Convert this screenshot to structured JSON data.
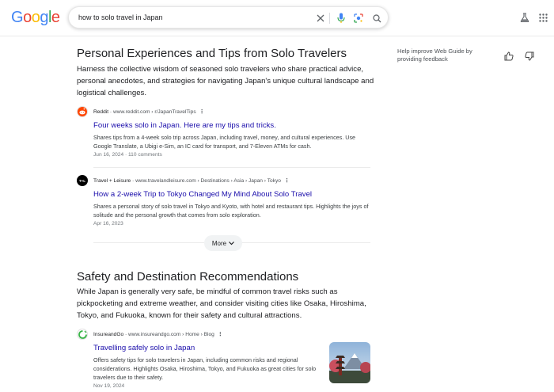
{
  "header": {
    "logo": [
      "G",
      "o",
      "o",
      "g",
      "l",
      "e"
    ],
    "logo_colors": [
      "#4285F4",
      "#EA4335",
      "#FBBC05",
      "#4285F4",
      "#34A853",
      "#EA4335"
    ],
    "search_query": "how to solo travel in Japan",
    "icons": [
      "close-icon",
      "microphone-icon",
      "lens-icon",
      "search-icon",
      "labs-flask-icon",
      "apps-grid-icon"
    ]
  },
  "sections": [
    {
      "title": "Personal Experiences and Tips from Solo Travelers",
      "description": "Harness the collective wisdom of seasoned solo travelers who share practical advice, personal anecdotes, and strategies for navigating Japan's unique cultural landscape and logistical challenges.",
      "results": [
        {
          "source": "Reddit",
          "url": "www.reddit.com › r/JapanTravelTips",
          "title": "Four weeks solo in Japan. Here are my tips and tricks.",
          "snippet": "Shares tips from a 4-week solo trip across Japan, including travel, money, and cultural experiences. Use Google Translate, a Ubigi e-Sim, an IC card for transport, and 7-Eleven ATMs for cash.",
          "meta": "Jun 16, 2024 · 110 comments"
        },
        {
          "source": "Travel + Leisure",
          "url": "www.travelandleisure.com › Destinations › Asia › Japan › Tokyo",
          "title": "How a 2-week Trip to Tokyo Changed My Mind About Solo Travel",
          "snippet": "Shares a personal story of solo travel in Tokyo and Kyoto, with hotel and restaurant tips. Highlights the joys of solitude and the personal growth that comes from solo exploration.",
          "meta": "Apr 16, 2023"
        }
      ],
      "more_label": "More"
    },
    {
      "title": "Safety and Destination Recommendations",
      "description": "While Japan is generally very safe, be mindful of common travel risks such as pickpocketing and extreme weather, and consider visiting cities like Osaka, Hiroshima, Tokyo, and Fukuoka, known for their safety and cultural attractions.",
      "results": [
        {
          "source": "InsureandGo",
          "url": "www.insureandgo.com › Home › Blog",
          "title": "Travelling safely solo in Japan",
          "snippet": "Offers safety tips for solo travelers in Japan, including common risks and regional considerations. Highlights Osaka, Hiroshima, Tokyo, and Fukuoka as great cities for solo travelers due to their safety.",
          "meta": "Nov 19, 2024"
        }
      ]
    }
  ],
  "side_panel": {
    "feedback_text": "Help improve Web Guide by providing feedback"
  },
  "favicons": {
    "reddit": "T+L",
    "tl_label": "T+L"
  }
}
